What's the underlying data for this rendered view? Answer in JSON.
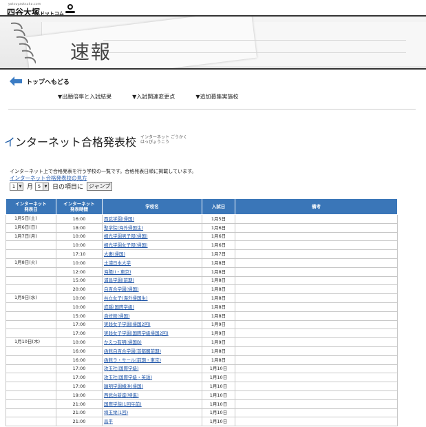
{
  "header": {
    "site_url": "yotsuyaotsuka.com",
    "site_name_main": "四谷大塚",
    "site_name_sub": "ドットコム",
    "banner_title": "速報"
  },
  "nav": {
    "back_label": "トップへもどる",
    "links": [
      "▼出願倍率と入試結果",
      "▼入試関連変更点",
      "▼追加募集実施校"
    ]
  },
  "section": {
    "title_first": "イ",
    "title_rest": "ンターネット合格発表校",
    "ruby_line1": "インターネット ごうかく",
    "ruby_line2": "はっぴょうこう",
    "description": "インターネット上で合格発表を行う学校の一覧です。合格発表日順に掲載しています。",
    "guide_link": "インターネット合格発表校の見方"
  },
  "jump": {
    "month_value": "1",
    "month_label": "月",
    "day_value": "5",
    "day_label": "日の項目に",
    "button_label": "ジャンプ"
  },
  "table": {
    "headers": [
      "インターネット\n発表日",
      "インターネット\n発表時間",
      "学校名",
      "入試日",
      "備考"
    ],
    "rows": [
      {
        "date": "1月5日(土)",
        "time": "16:00",
        "school": "西武学園(帰国)",
        "exam": "1月5日"
      },
      {
        "date": "1月6日(日)",
        "time": "18:00",
        "school": "聖学院(海外帰国生)",
        "exam": "1月6日"
      },
      {
        "date": "1月7日(月)",
        "time": "10:00",
        "school": "桐光学園男子部(帰国)",
        "exam": "1月6日"
      },
      {
        "date": "",
        "time": "10:00",
        "school": "桐光学園女子部(帰国)",
        "exam": "1月6日"
      },
      {
        "date": "",
        "time": "17:10",
        "school": "大妻(帰国)",
        "exam": "1月7日"
      },
      {
        "date": "1月8日(火)",
        "time": "10:00",
        "school": "土浦日本大学",
        "exam": "1月8日"
      },
      {
        "date": "",
        "time": "12:00",
        "school": "海陽(Ⅰ・東京)",
        "exam": "1月8日"
      },
      {
        "date": "",
        "time": "15:00",
        "school": "浦昌学園(前期)",
        "exam": "1月8日"
      },
      {
        "date": "",
        "time": "20:00",
        "school": "白百合学園(帰国)",
        "exam": "1月8日"
      },
      {
        "date": "1月9日(水)",
        "time": "10:00",
        "school": "共立女子(海外帰国生)",
        "exam": "1月8日"
      },
      {
        "date": "",
        "time": "10:00",
        "school": "成蹊(国際学級)",
        "exam": "1月8日"
      },
      {
        "date": "",
        "time": "15:00",
        "school": "自修館(帰国)",
        "exam": "1月8日"
      },
      {
        "date": "",
        "time": "17:00",
        "school": "実践女子学園(帰国2回)",
        "exam": "1月9日"
      },
      {
        "date": "",
        "time": "17:00",
        "school": "実践女子学園(国際学級帰国2回)",
        "exam": "1月9日"
      },
      {
        "date": "1月10日(木)",
        "time": "10:00",
        "school": "かえつ有明(帰国B)",
        "exam": "1月9日"
      },
      {
        "date": "",
        "time": "16:00",
        "school": "函館白百合学園(首都圏前期)",
        "exam": "1月8日"
      },
      {
        "date": "",
        "time": "16:00",
        "school": "函館ラ・サール(前期・東京)",
        "exam": "1月8日"
      },
      {
        "date": "",
        "time": "17:00",
        "school": "攻玉社(国際学級)",
        "exam": "1月10日"
      },
      {
        "date": "",
        "time": "17:00",
        "school": "攻玉社(国際学級・英語)",
        "exam": "1月10日"
      },
      {
        "date": "",
        "time": "17:00",
        "school": "穎明学園横浜(帰国)",
        "exam": "1月10日"
      },
      {
        "date": "",
        "time": "19:00",
        "school": "西武台新座(特進)",
        "exam": "1月10日"
      },
      {
        "date": "",
        "time": "21:00",
        "school": "国際学院(1回午前)",
        "exam": "1月10日"
      },
      {
        "date": "",
        "time": "21:00",
        "school": "埼玉栄(1回)",
        "exam": "1月10日"
      },
      {
        "date": "",
        "time": "21:00",
        "school": "昌平",
        "exam": "1月10日"
      }
    ]
  },
  "colors": {
    "header_blue": "#3a76b8",
    "link_blue": "#1f55a8",
    "arrow_blue": "#3b7cc4"
  }
}
